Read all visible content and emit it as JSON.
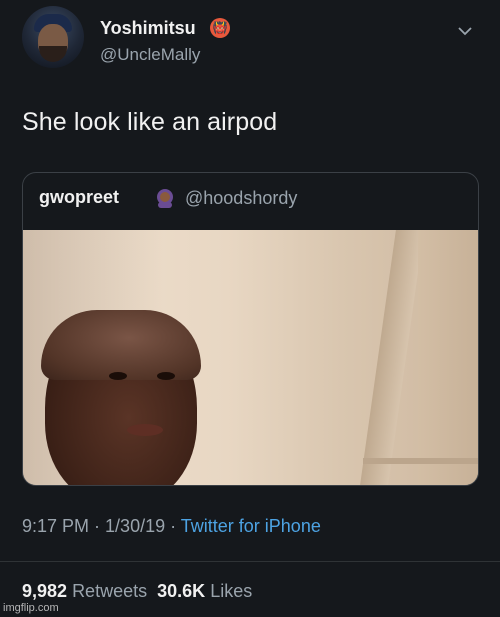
{
  "author": {
    "display_name": "Yoshimitsu",
    "handle": "@UncleMally",
    "name_emoji": "👹"
  },
  "tweet": {
    "text": "She look like an airpod"
  },
  "quoted": {
    "display_name": "gwopreet",
    "emoji": "woman-with-headscarf-emoji",
    "handle": "@hoodshordy"
  },
  "meta": {
    "time": "9:17 PM",
    "sep1": " · ",
    "date": "1/30/19",
    "sep2": " · ",
    "source": "Twitter for iPhone"
  },
  "stats": {
    "retweets_count": "9,982",
    "retweets_label": "Retweets",
    "likes_count": "30.6K",
    "likes_label": "Likes"
  },
  "watermark": "imgflip.com",
  "colors": {
    "background": "#15181c",
    "link": "#4da3e3",
    "secondary_text": "#9aa4ad"
  }
}
